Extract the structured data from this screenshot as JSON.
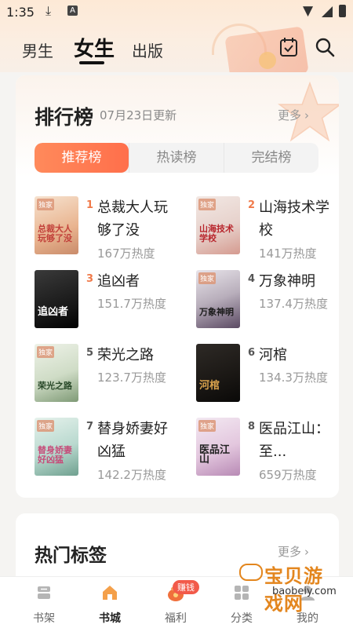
{
  "status_bar": {
    "time": "1:35",
    "a_badge": "A"
  },
  "top_tabs": [
    {
      "label": "男生",
      "active": false
    },
    {
      "label": "女生",
      "active": true
    },
    {
      "label": "出版",
      "active": false
    }
  ],
  "ranking": {
    "title": "排行榜",
    "date": "07月23日更新",
    "more": "更多",
    "segments": [
      {
        "label": "推荐榜",
        "active": true
      },
      {
        "label": "热读榜",
        "active": false
      },
      {
        "label": "完结榜",
        "active": false
      }
    ],
    "books": [
      {
        "rank": "1",
        "name": "总裁大人玩够了没",
        "heat": "167万热度",
        "cover_text": "总裁大人玩够了没",
        "exclusive": "独家"
      },
      {
        "rank": "2",
        "name": "山海技术学校",
        "heat": "141万热度",
        "cover_text": "山海技术学校",
        "exclusive": "独家"
      },
      {
        "rank": "3",
        "name": "追凶者",
        "heat": "151.7万热度",
        "cover_text": "追凶者",
        "exclusive": ""
      },
      {
        "rank": "4",
        "name": "万象神明",
        "heat": "137.4万热度",
        "cover_text": "万象神明",
        "exclusive": "独家"
      },
      {
        "rank": "5",
        "name": "荣光之路",
        "heat": "123.7万热度",
        "cover_text": "荣光之路",
        "exclusive": "独家"
      },
      {
        "rank": "6",
        "name": "河棺",
        "heat": "134.3万热度",
        "cover_text": "河棺",
        "exclusive": ""
      },
      {
        "rank": "7",
        "name": "替身娇妻好凶猛",
        "heat": "142.2万热度",
        "cover_text": "替身娇妻好凶猛",
        "exclusive": "独家"
      },
      {
        "rank": "8",
        "name": "医品江山：至...",
        "heat": "659万热度",
        "cover_text": "医品江山",
        "exclusive": "独家"
      }
    ]
  },
  "hot_tags": {
    "title": "热门标签",
    "more": "更多"
  },
  "bottom_nav": [
    {
      "label": "书架",
      "active": false
    },
    {
      "label": "书城",
      "active": true
    },
    {
      "label": "福利",
      "active": false,
      "badge": "赚钱"
    },
    {
      "label": "分类",
      "active": false
    },
    {
      "label": "我的",
      "active": false
    }
  ],
  "watermark": {
    "text": "宝贝游戏网",
    "url": "baobeiy.com"
  },
  "colors": {
    "accent": "#ff7a50",
    "rank_hot": "#f07a4a",
    "active_nav": "#f08a3a"
  }
}
